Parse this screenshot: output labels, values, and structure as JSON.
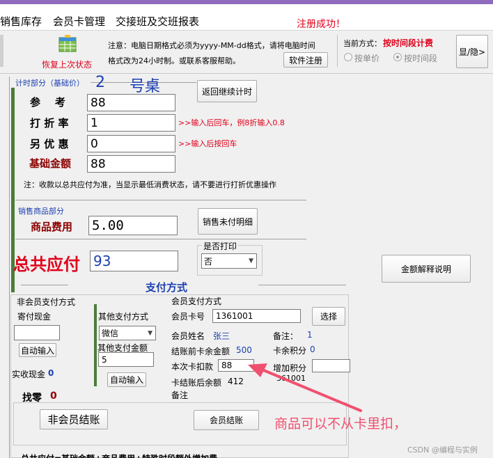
{
  "menu": {
    "items": [
      "销售库存",
      "会员卡管理",
      "交接班及交班报表"
    ],
    "status": "注册成功！"
  },
  "toolbar": {
    "restore_label": "恢复上次状态",
    "notice_line1": "注意：电脑日期格式必须为yyyy-MM-dd格式，请将电脑时间",
    "notice_line2": "格式改为24小时制。或联系客服帮助。",
    "register_btn": "软件注册",
    "mode_label": "当前方式：",
    "mode_value": "按时间段计费",
    "opt_unit_price": "按单价",
    "opt_time_period": "按时间段",
    "show_hide_btn": "显/隐>"
  },
  "timing": {
    "section_title": "计时部分（基础价）",
    "table_no": "2",
    "table_suffix": "号桌",
    "return_btn": "返回继续计时",
    "ref_label": "参    考",
    "ref_value": "88",
    "discount_label": "打 折 率",
    "discount_value": "1",
    "discount_hint": ">>输入后回车，例8折输入0.8",
    "extra_label": "另 优 惠",
    "extra_value": "0",
    "extra_hint": ">>输入后按回车",
    "base_label": "基础金额",
    "base_value": "88",
    "note": "注：收款以总共应付为准，当显示最低消费状态，请不要进行打折优惠操作"
  },
  "sales": {
    "section_title": "销售商品部分",
    "goods_label": "商品费用",
    "goods_value": "5.00",
    "unpaid_btn": "销售未付明细"
  },
  "total": {
    "label": "总共应付",
    "value": "93",
    "print_label": "是否打印",
    "print_value": "否",
    "explain_btn": "金额解释说明"
  },
  "payment": {
    "title": "支付方式",
    "non_member_title": "非会员支付方式",
    "deposit_label": "寄付现金",
    "deposit_value": "",
    "auto_input_1": "自动输入",
    "actual_cash_label": "实收现金",
    "actual_cash_value": "0",
    "other_title": "其他支付方式",
    "other_method": "微信",
    "other_amount_label": "其他支付金额",
    "other_amount_value": "5",
    "auto_input_2": "自动输入",
    "change_label": "找零",
    "change_value": "0",
    "member_title": "会员支付方式",
    "card_no_label": "会员卡号",
    "card_no_value": "1361001",
    "select_btn": "选择",
    "name_label": "会员姓名",
    "name_value": "张三",
    "remark_label": "备注：",
    "remark_value": "1",
    "before_balance_label": "结账前卡余金额",
    "before_balance_value": "500",
    "points_label": "卡余积分",
    "points_value": "0",
    "deduct_label": "本次卡扣款",
    "deduct_value": "88",
    "add_points_label": "增加积分",
    "add_points_value": "",
    "card_partial": "361001",
    "after_balance_label": "卡结账后余额",
    "after_balance_value": "412",
    "remark2_label": "备注",
    "non_member_checkout_btn": "非会员结账",
    "member_checkout_btn": "会员结账"
  },
  "annotation": {
    "text": "商品可以不从卡里扣，",
    "color": "#f0506e"
  },
  "bottom_partial": "总共应付=基础金额+商品费用+特殊时段额外增加费",
  "watermark": "CSDN @编程与实例"
}
